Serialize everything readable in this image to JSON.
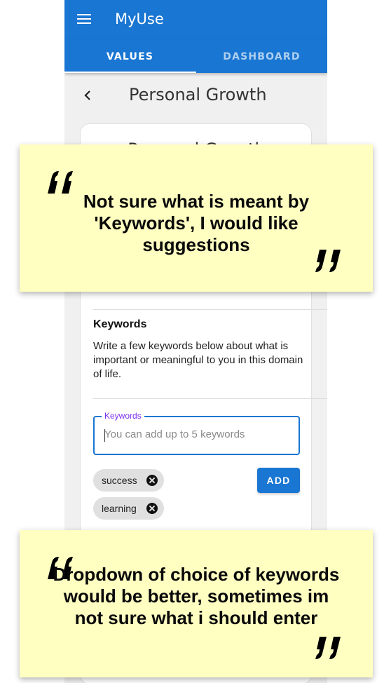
{
  "app": {
    "title": "MyUse"
  },
  "tabs": [
    {
      "label": "VALUES",
      "active": true
    },
    {
      "label": "DASHBOARD",
      "active": false
    }
  ],
  "page": {
    "title": "Personal Growth"
  },
  "card": {
    "title": "Personal Growth",
    "keywords_heading": "Keywords",
    "keywords_description": "Write a few keywords below about what is important or meaningful to you in this domain of life.",
    "input_label": "Keywords",
    "input_placeholder": "You can add up to 5 keywords",
    "input_value": "",
    "add_label": "ADD",
    "chips": [
      "success",
      "learning"
    ]
  },
  "notes": [
    {
      "text": "Not sure what is meant by 'Keywords', I would like suggestions"
    },
    {
      "text": "Dropdown of choice of keywords would be better, sometimes im not sure what i should enter"
    }
  ],
  "colors": {
    "primary": "#1976d2",
    "note_background": "#ffffc2",
    "label_accent": "#7b2ff2"
  },
  "icons": [
    "menu-icon",
    "back-icon",
    "cancel-icon",
    "quote-open-icon",
    "quote-close-icon"
  ]
}
